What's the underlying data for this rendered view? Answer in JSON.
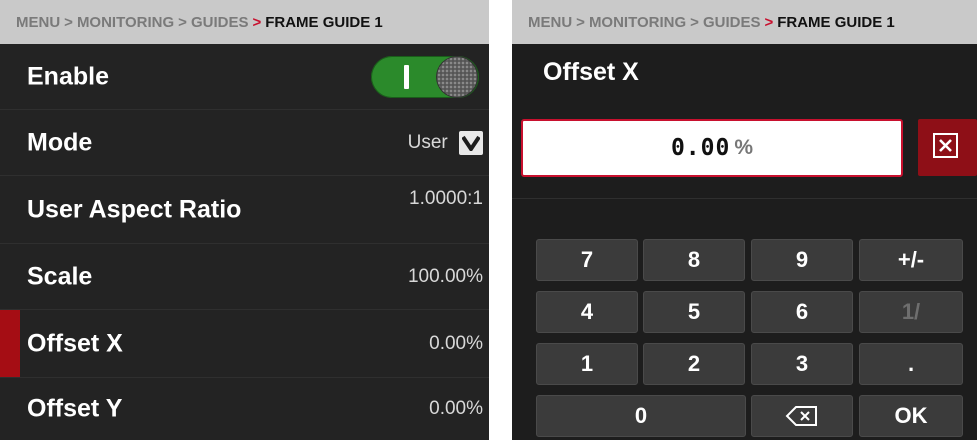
{
  "breadcrumb": {
    "items": [
      "MENU",
      "MONITORING",
      "GUIDES"
    ],
    "separator": ">",
    "current": "FRAME GUIDE 1"
  },
  "settings": {
    "rows": [
      {
        "label": "Enable",
        "control": "toggle",
        "state": "on"
      },
      {
        "label": "Mode",
        "value": "User",
        "control": "dropdown"
      },
      {
        "label": "User Aspect Ratio",
        "value": "1.0000:1"
      },
      {
        "label": "Scale",
        "value": "100.00%"
      },
      {
        "label": "Offset X",
        "value": "0.00%",
        "selected": true
      },
      {
        "label": "Offset Y",
        "value": "0.00%"
      }
    ]
  },
  "editor": {
    "title": "Offset X",
    "entry_value": "0.00",
    "entry_unit": "%",
    "clear_icon": "close-box-icon"
  },
  "keypad": {
    "keys": [
      "7",
      "8",
      "9",
      "+/-",
      "4",
      "5",
      "6",
      "1/",
      "1",
      "2",
      "3",
      ".",
      "0",
      "backspace",
      "OK"
    ]
  },
  "colors": {
    "accent_red": "#c8102e",
    "toggle_green": "#2b8a2b",
    "panel_bg": "#1d1d1d",
    "breadcrumb_bg": "#c9c9c9"
  }
}
